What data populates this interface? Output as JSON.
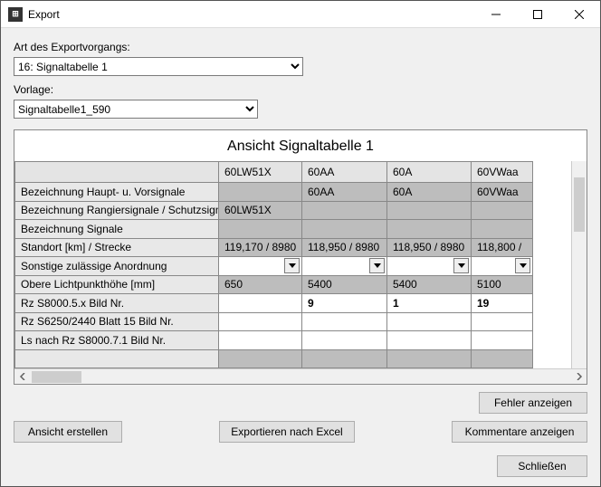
{
  "window": {
    "title": "Export"
  },
  "labels": {
    "exportType": "Art des Exportvorgangs:",
    "template": "Vorlage:"
  },
  "exportType": {
    "selected": "16: Signaltabelle 1"
  },
  "template": {
    "selected": "Signaltabelle1_590"
  },
  "table": {
    "title": "Ansicht Signaltabelle 1",
    "columns": [
      "60LW51X",
      "60AA",
      "60A",
      "60VWaa"
    ],
    "rows": [
      {
        "label": "Bezeichnung Haupt- u. Vorsignale",
        "shaded": true,
        "cells": [
          "",
          "60AA",
          "60A",
          "60VWaa"
        ]
      },
      {
        "label": "Bezeichnung Rangiersignale / Schutzsignale",
        "shaded": true,
        "cells": [
          "60LW51X",
          "",
          "",
          ""
        ]
      },
      {
        "label": "Bezeichnung Signale",
        "shaded": true,
        "cells": [
          "",
          "",
          "",
          ""
        ]
      },
      {
        "label": "Standort [km] / Strecke",
        "shaded": true,
        "cells": [
          "119,170 / 8980",
          "118,950 / 8980",
          "118,950 / 8980",
          "118,800 /"
        ]
      },
      {
        "label": "Sonstige zulässige Anordnung",
        "shaded": false,
        "dropdown": true,
        "cells": [
          "",
          "",
          "",
          ""
        ]
      },
      {
        "label": "Obere Lichtpunkthöhe [mm]",
        "shaded": true,
        "cells": [
          "650",
          "5400",
          "5400",
          "5100"
        ]
      },
      {
        "label": "Rz S8000.5.x Bild Nr.",
        "shaded": false,
        "bold": true,
        "cells": [
          "",
          "9",
          "1",
          "19"
        ]
      },
      {
        "label": "Rz S6250/2440 Blatt 15 Bild Nr.",
        "shaded": false,
        "cells": [
          "",
          "",
          "",
          ""
        ]
      },
      {
        "label": "Ls nach Rz S8000.7.1 Bild Nr.",
        "shaded": false,
        "cells": [
          "",
          "",
          "",
          ""
        ]
      },
      {
        "label": "",
        "shaded": true,
        "cells": [
          "",
          "",
          "",
          ""
        ]
      }
    ]
  },
  "buttons": {
    "showErrors": "Fehler anzeigen",
    "createView": "Ansicht erstellen",
    "exportExcel": "Exportieren nach Excel",
    "showComments": "Kommentare anzeigen",
    "close": "Schließen"
  }
}
